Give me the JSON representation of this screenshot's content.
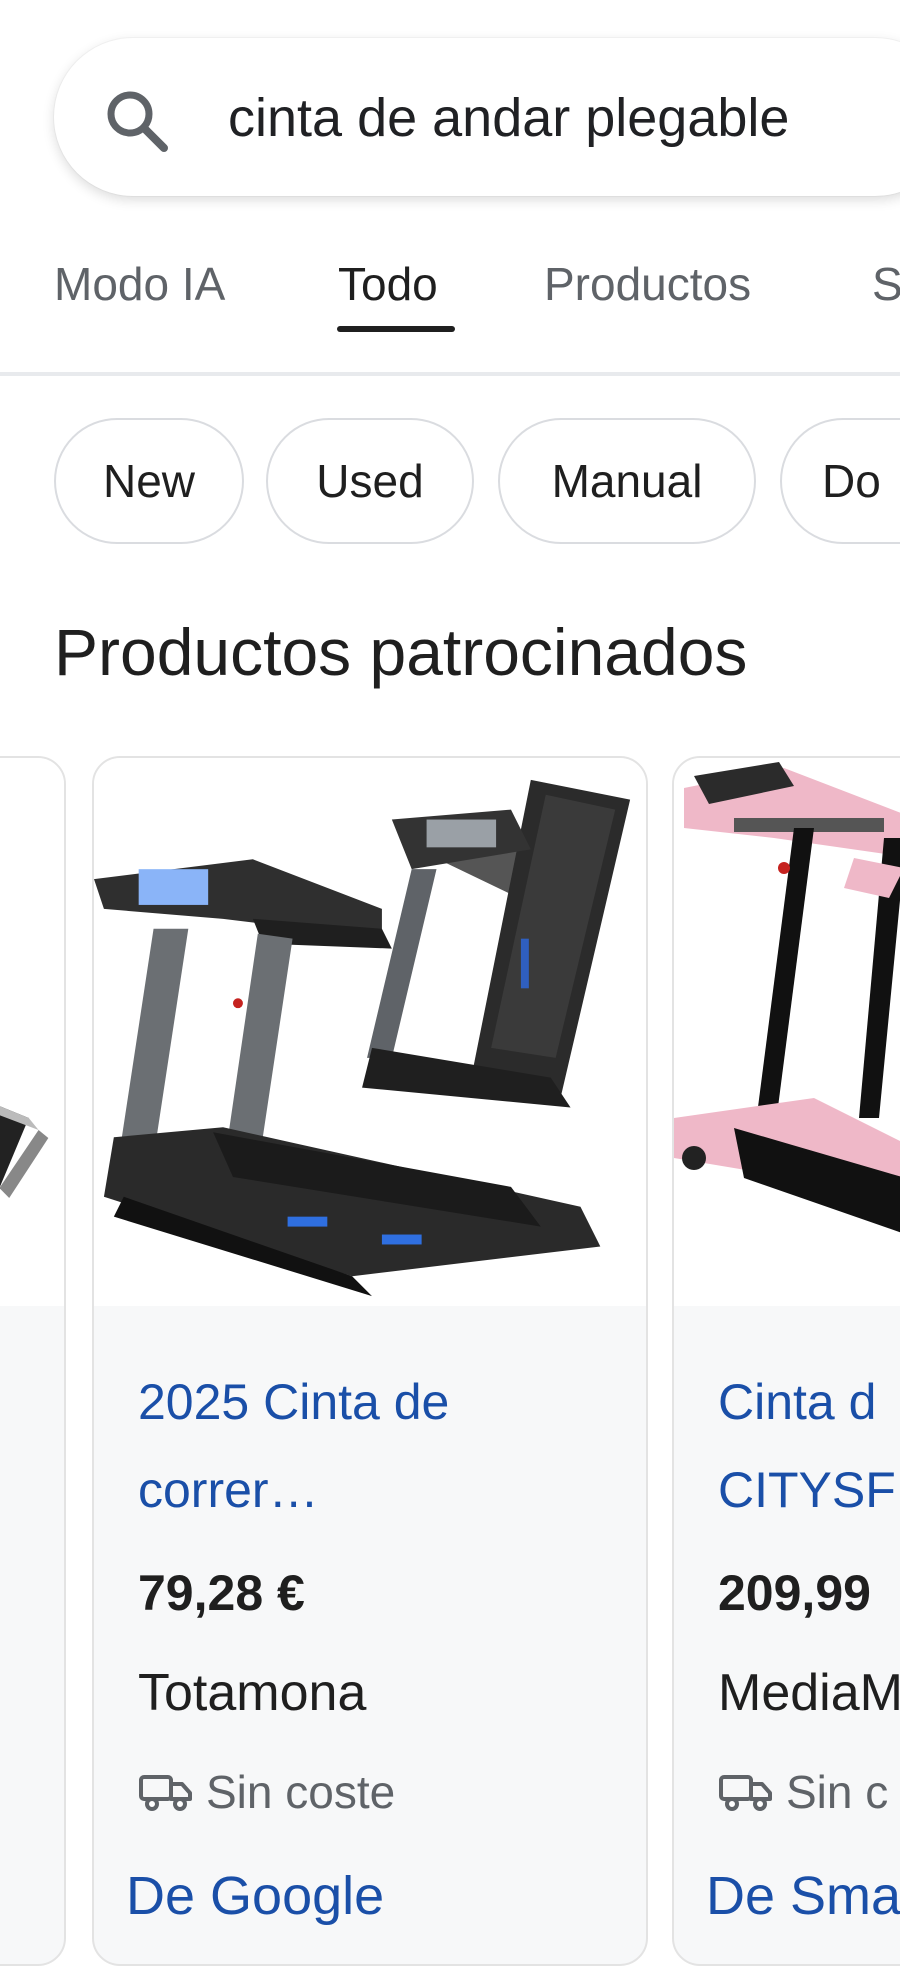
{
  "search": {
    "query": "cinta de andar plegable",
    "icon": "search-icon"
  },
  "tabs": [
    {
      "label": "Modo IA",
      "active": false
    },
    {
      "label": "Todo",
      "active": true
    },
    {
      "label": "Productos",
      "active": false
    },
    {
      "label": "S",
      "active": false
    }
  ],
  "chips": [
    {
      "label": "New"
    },
    {
      "label": "Used"
    },
    {
      "label": "Manual"
    },
    {
      "label": "Do"
    }
  ],
  "section": {
    "title": "Productos patrocinados"
  },
  "products": [
    {
      "title": "2025 Cinta de\ncorrer…",
      "price": "79,28 €",
      "seller": "Totamona",
      "shipping": "Sin coste",
      "source": "De Google",
      "image": "black-folding-treadmill"
    },
    {
      "title": "Cinta d\nCITYSF",
      "price": "209,99",
      "seller": "MediaM",
      "shipping": "Sin c",
      "source": "De Sma",
      "image": "pink-treadmill"
    }
  ],
  "colors": {
    "link": "#1a4fa8",
    "chip_border": "#dadce0",
    "card_bg": "#f7f8f9"
  }
}
